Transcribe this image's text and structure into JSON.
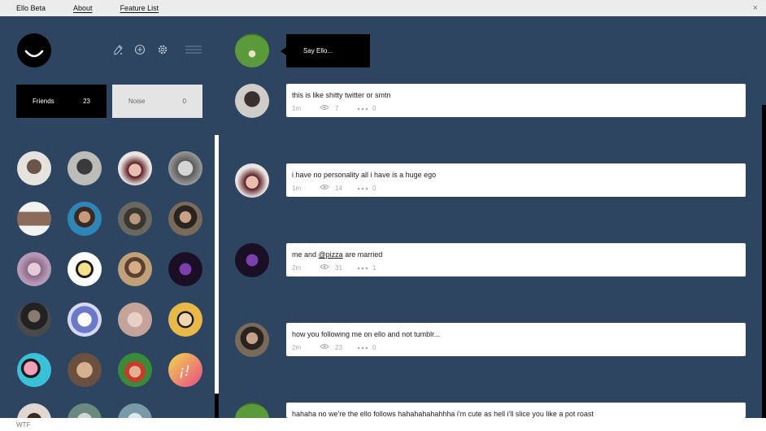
{
  "topbar": {
    "items": [
      "Ello Beta",
      "About",
      "Feature List"
    ],
    "close": "×"
  },
  "toolbar_icons": [
    "pen-icon",
    "plus-circle-icon",
    "gear-icon",
    "hamburger-icon"
  ],
  "tabs": {
    "friends": {
      "label": "Friends",
      "count": "23"
    },
    "noise": {
      "label": "Noise",
      "count": "0"
    }
  },
  "composer": {
    "placeholder": "Say Ello..."
  },
  "posts": [
    {
      "text": "this is like shitty twitter or smtn",
      "time": "1m",
      "views": "7",
      "comments": "0"
    },
    {
      "text": "i have no personality all i have is a huge ego",
      "time": "1m",
      "views": "14",
      "comments": "0"
    },
    {
      "text_before": "me and ",
      "mention": "@pizza",
      "text_after": " are married",
      "time": "2m",
      "views": "31",
      "comments": "1"
    },
    {
      "text": "how you following me on ello and not tumblr...",
      "time": "2m",
      "views": "23",
      "comments": "0"
    },
    {
      "text": "hahaha no we're the ello follows hahahahahahhha i'm cute as hell i'll slice you like a pot roast",
      "time": "",
      "views": "",
      "comments": ""
    }
  ],
  "bottom": {
    "text": "WTF"
  },
  "colors": {
    "background": "#2d4561",
    "card": "#ffffff",
    "tab_active": "#000000",
    "tab_inactive": "#e4e4e4"
  }
}
